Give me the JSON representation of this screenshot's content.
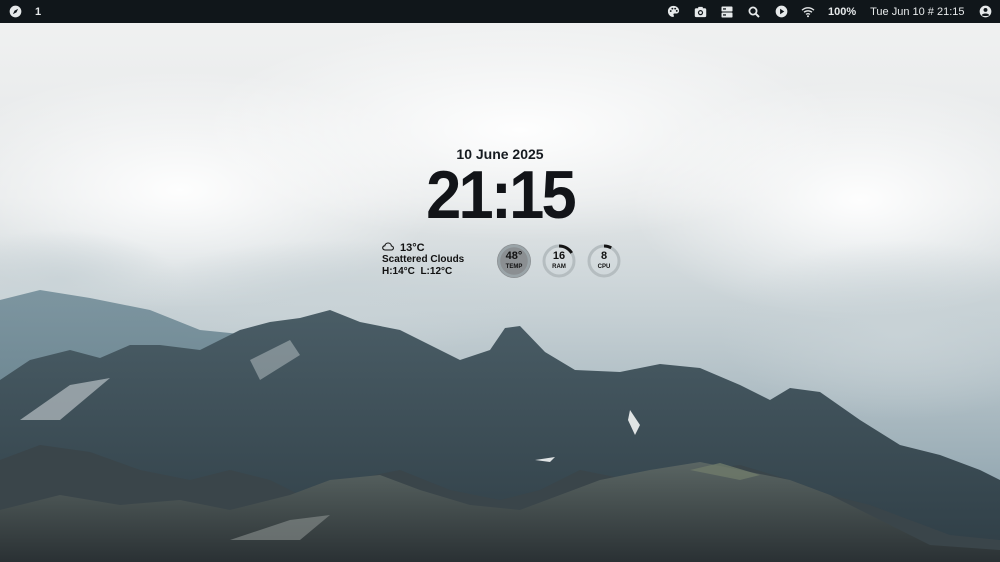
{
  "topbar": {
    "launcher_icon": "compass-icon",
    "workspace": "1",
    "tray_icons": [
      "palette-icon",
      "camera-icon",
      "dashboard-icon",
      "search-icon",
      "play-icon",
      "wifi-icon"
    ],
    "battery": "100%",
    "clock": "Tue Jun 10 # 21:15",
    "user_icon": "account-icon"
  },
  "widget": {
    "date": "10 June 2025",
    "time": "21:15",
    "weather": {
      "icon": "cloud-icon",
      "temp": "13°C",
      "condition": "Scattered Clouds",
      "high_low": "H:14°C  L:12°C"
    },
    "gauges": [
      {
        "value": "48°",
        "label": "TEMP",
        "fraction": 0.48
      },
      {
        "value": "16",
        "label": "RAM",
        "fraction": 0.16
      },
      {
        "value": "8",
        "label": "CPU",
        "fraction": 0.08
      }
    ]
  },
  "colors": {
    "bar_bg": "#10161a",
    "bar_fg": "#e6e9ea",
    "gauge_track": "#9aa4a8",
    "gauge_fill": "#141414",
    "temp_bg": "#8b8f92"
  }
}
